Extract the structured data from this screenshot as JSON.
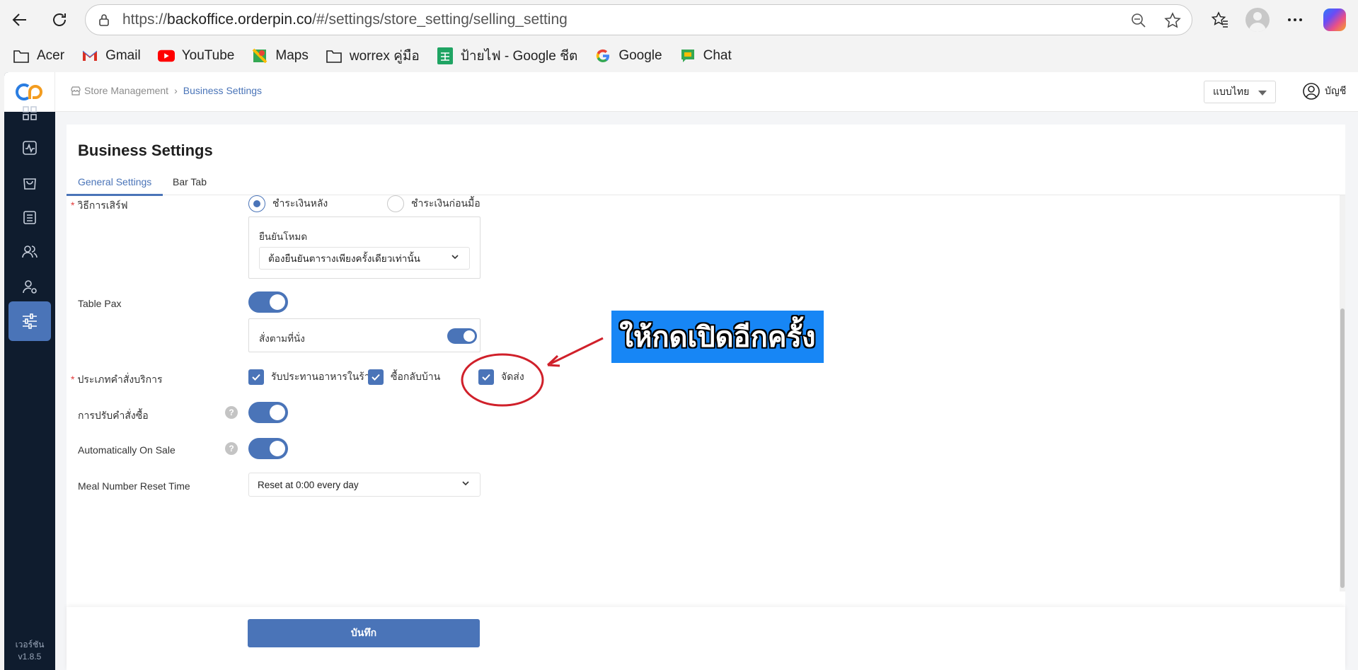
{
  "browser": {
    "url_prefix": "https://",
    "url_host": "backoffice.orderpin.co",
    "url_path": "/#/settings/store_setting/selling_setting",
    "bookmarks": [
      {
        "label": "Acer",
        "icon": "folder-icon"
      },
      {
        "label": "Gmail",
        "icon": "gmail-icon"
      },
      {
        "label": "YouTube",
        "icon": "youtube-icon"
      },
      {
        "label": "Maps",
        "icon": "maps-icon"
      },
      {
        "label": "worrex คู่มือ",
        "icon": "folder-icon"
      },
      {
        "label": "ป้ายไฟ - Google ชีต",
        "icon": "sheets-icon"
      },
      {
        "label": "Google",
        "icon": "google-icon"
      },
      {
        "label": "Chat",
        "icon": "chat-icon"
      }
    ]
  },
  "app": {
    "version_label": "เวอร์ชัน",
    "version": "v1.8.5",
    "sidebar_icons": [
      "dashboard-icon",
      "activity-icon",
      "shopping-bag-icon",
      "building-icon",
      "users-icon",
      "user-settings-icon",
      "sliders-icon"
    ],
    "active_sidebar_index": 6
  },
  "topbar": {
    "breadcrumb": {
      "root": "Store Management",
      "current": "Business Settings"
    },
    "language": "แบบไทย",
    "account": "บัญชี"
  },
  "page": {
    "title": "Business Settings",
    "tabs": [
      {
        "label": "General Settings",
        "active": true
      },
      {
        "label": "Bar Tab",
        "active": false
      }
    ],
    "service_method": {
      "label": "วิธีการเสิร์ฟ",
      "required": true,
      "options": [
        {
          "label": "ชำระเงินหลัง",
          "selected": true
        },
        {
          "label": "ชำระเงินก่อนมื้อ",
          "selected": false
        }
      ],
      "confirm_mode_label": "ยืนยันโหมด",
      "confirm_mode_value": "ต้องยืนยันตารางเพียงครั้งเดียวเท่านั้น"
    },
    "table_pax": {
      "label": "Table Pax",
      "enabled": true,
      "sub_label": "สั่งตามที่นั่ง",
      "sub_enabled": true
    },
    "order_types": {
      "label": "ประเภทคำสั่งบริการ",
      "required": true,
      "options": [
        {
          "label": "รับประทานอาหารในร้าน",
          "checked": true
        },
        {
          "label": "ซื้อกลับบ้าน",
          "checked": true
        },
        {
          "label": "จัดส่ง",
          "checked": true
        }
      ]
    },
    "order_adjust": {
      "label": "การปรับคำสั่งซื้อ",
      "enabled": true,
      "help": "?"
    },
    "auto_on_sale": {
      "label": "Automatically On Sale",
      "enabled": true,
      "help": "?"
    },
    "meal_reset": {
      "label": "Meal Number Reset Time",
      "value": "Reset at 0:00 every day"
    },
    "save_label": "บันทึก"
  },
  "annotation": {
    "text": "ให้กดเปิดอีกครั้ง",
    "box_color": "#1786f5",
    "circle_color": "#d0202a"
  },
  "colors": {
    "primary": "#4a74b8",
    "sidebar_bg": "#0f1c2e",
    "required": "#e23c3c"
  }
}
